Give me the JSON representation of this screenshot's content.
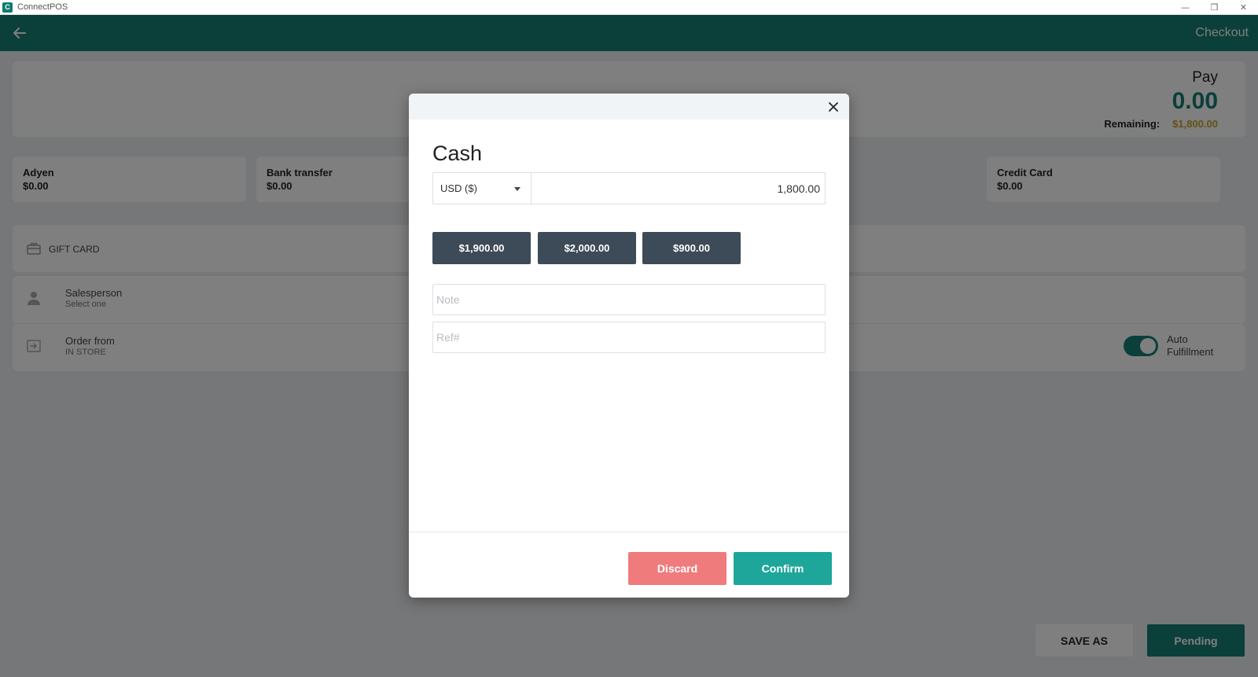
{
  "window": {
    "app_name": "ConnectPOS",
    "logo_text": "C",
    "minimize_icon": "—",
    "maximize_icon": "❐",
    "close_icon": "✕"
  },
  "header": {
    "title": "Checkout",
    "back_icon": "arrow-left-icon"
  },
  "payment_summary": {
    "pay_label": "Pay",
    "pay_amount": "0.00",
    "remaining_label": "Remaining:",
    "remaining_value": "$1,800.00"
  },
  "payment_methods": [
    {
      "name": "Adyen",
      "amount": "$0.00"
    },
    {
      "name": "Bank transfer",
      "amount": "$0.00"
    },
    {
      "name": "Credit Card",
      "amount": "$0.00"
    }
  ],
  "gift_card": {
    "label": "GIFT CARD"
  },
  "salesperson": {
    "label": "Salesperson",
    "value": "Select one"
  },
  "order_from": {
    "label": "Order from",
    "value": "IN STORE"
  },
  "auto_fulfillment": {
    "label": "Auto Fulfillment",
    "enabled": true
  },
  "footer": {
    "save_as_label": "SAVE AS",
    "pending_label": "Pending"
  },
  "modal": {
    "title": "Cash",
    "currency": "USD ($)",
    "amount": "1,800.00",
    "quick_amounts": [
      "$1,900.00",
      "$2,000.00",
      "$900.00"
    ],
    "note_placeholder": "Note",
    "ref_placeholder": "Ref#",
    "discard_label": "Discard",
    "confirm_label": "Confirm"
  },
  "colors": {
    "brand": "#177e72",
    "remaining": "#c9a227",
    "quick_button": "#3d4a57",
    "discard": "#f07b7d",
    "confirm": "#1ea69a"
  }
}
